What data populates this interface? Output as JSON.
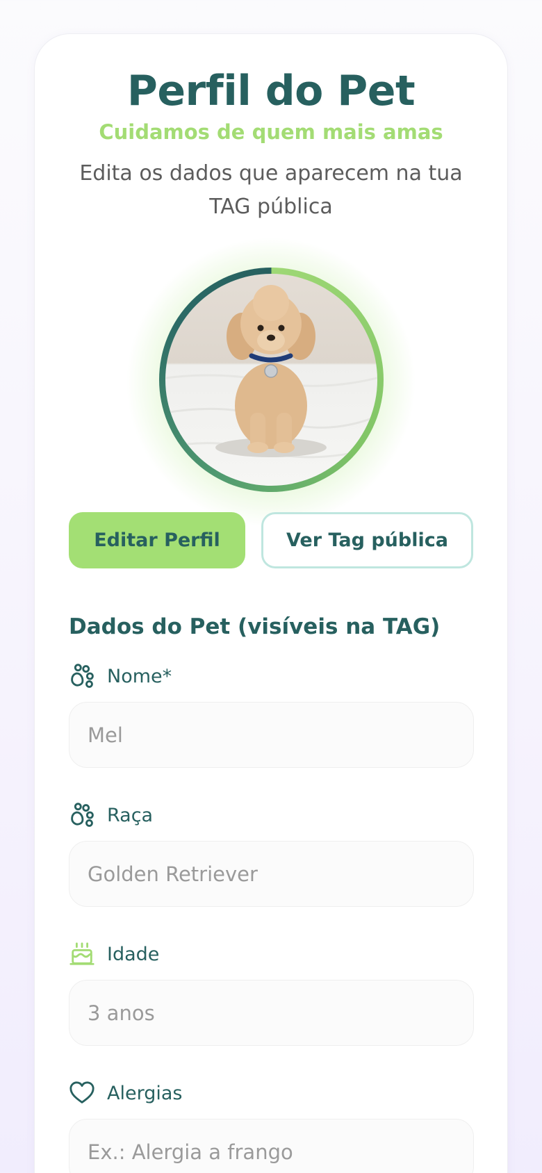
{
  "header": {
    "title": "Perfil do Pet",
    "tagline": "Cuidamos de quem mais amas",
    "subtitle": "Edita os dados que aparecem na tua TAG pública"
  },
  "avatar": {
    "alt": "Foto do pet"
  },
  "actions": {
    "edit_label": "Editar Perfil",
    "view_tag_label": "Ver Tag pública"
  },
  "form": {
    "section_title": "Dados do Pet (visíveis na TAG)",
    "fields": [
      {
        "label": "Nome*",
        "placeholder": "Mel",
        "icon": "paw-icon"
      },
      {
        "label": "Raça",
        "placeholder": "Golden Retriever",
        "icon": "paw-icon"
      },
      {
        "label": "Idade",
        "placeholder": "3 anos",
        "icon": "cake-icon"
      },
      {
        "label": "Alergias",
        "placeholder": "Ex.: Alergia a frango",
        "icon": "heart-icon"
      }
    ]
  },
  "colors": {
    "primary": "#27605f",
    "accent": "#a3df74",
    "outline": "#bfe6df"
  }
}
